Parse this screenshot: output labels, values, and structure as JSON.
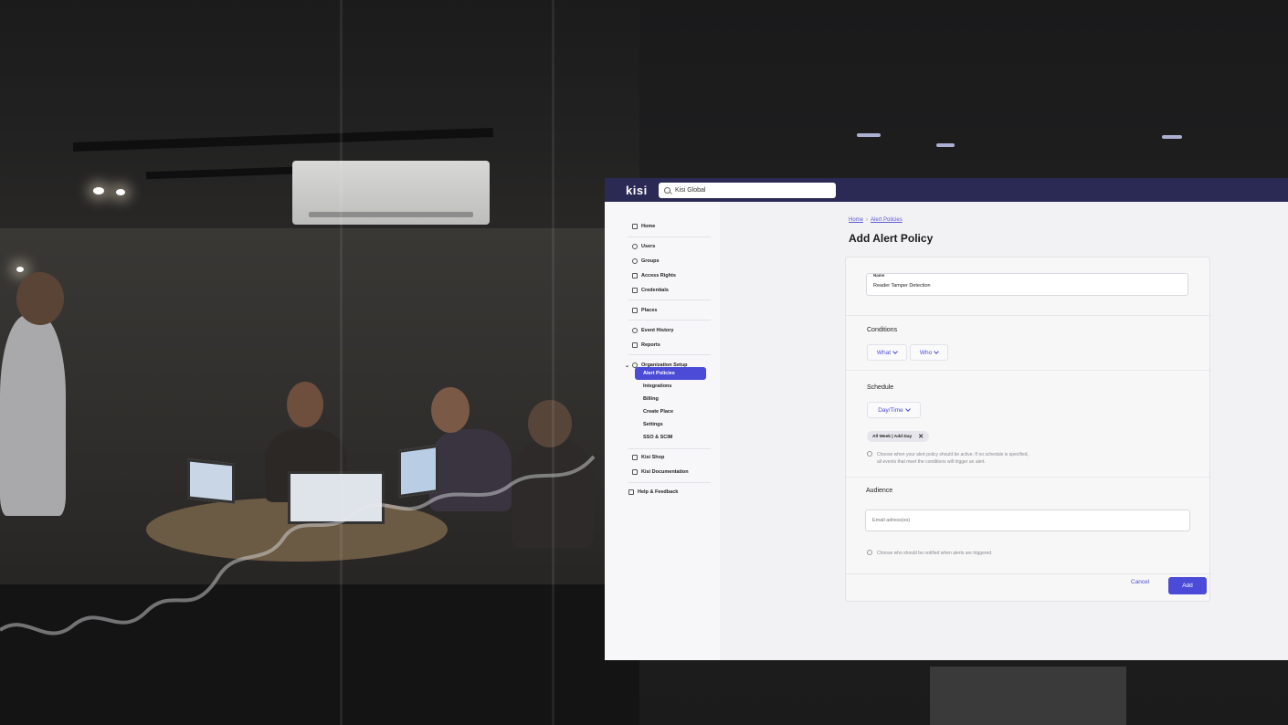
{
  "app": {
    "logo": "kisi",
    "search": {
      "value": "Kisi Global"
    }
  },
  "sidebar": {
    "items": [
      {
        "label": "Home",
        "icon": "home-icon"
      },
      {
        "label": "Users",
        "icon": "user-icon"
      },
      {
        "label": "Groups",
        "icon": "groups-icon"
      },
      {
        "label": "Access Rights",
        "icon": "access-rights-icon"
      },
      {
        "label": "Credentials",
        "icon": "credentials-icon"
      },
      {
        "label": "Places",
        "icon": "places-icon"
      },
      {
        "label": "Event History",
        "icon": "event-history-icon"
      },
      {
        "label": "Reports",
        "icon": "reports-icon"
      },
      {
        "label": "Organization Setup",
        "icon": "gear-icon"
      },
      {
        "label": "Kisi Shop",
        "icon": "shop-icon"
      },
      {
        "label": "Kisi Documentation",
        "icon": "document-icon"
      },
      {
        "label": "Help & Feedback",
        "icon": "help-icon"
      }
    ],
    "org_sub": [
      "Alert Policies",
      "Integrations",
      "Billing",
      "Create Place",
      "Settings",
      "SSO & SCIM"
    ]
  },
  "breadcrumb": {
    "home": "Home",
    "current": "Alert Policies",
    "separator": "›"
  },
  "page_title": "Add Alert Policy",
  "form": {
    "name_label": "Name",
    "name_value": "Reader Tamper Detection",
    "conditions_title": "Conditions",
    "what_label": "What",
    "who_label": "Who",
    "schedule_title": "Schedule",
    "daytime_label": "Day/Time",
    "chip_label": "All Week | Add Day",
    "chip_close": "✕",
    "schedule_hint_1": "Choose when your alert policy should be active. If no schedule is specified,",
    "schedule_hint_2": "all events that meet the conditions will trigger an alert.",
    "audience_title": "Audience",
    "email_placeholder": "Email adress(es)",
    "audience_hint": "Choose who should be notified when alerts are triggered.",
    "cancel_label": "Cancel",
    "add_label": "Add"
  },
  "colors": {
    "accent": "#4b4bd8",
    "topbar": "#2b2a55"
  }
}
